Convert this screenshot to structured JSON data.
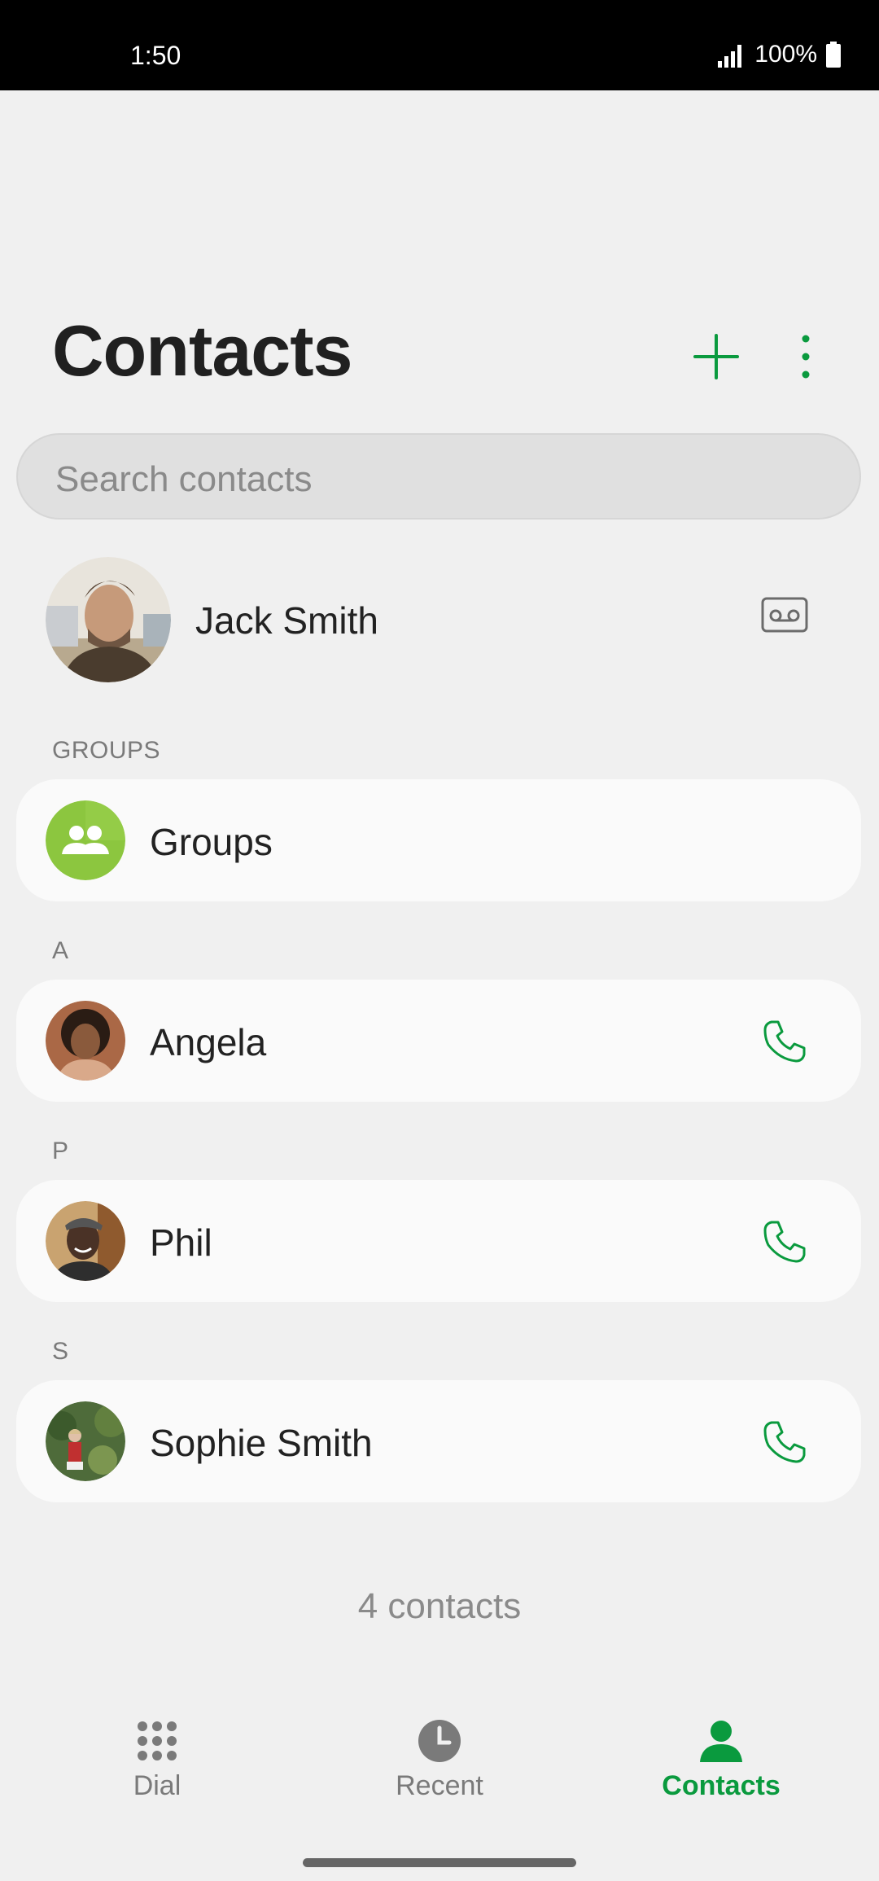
{
  "status_bar": {
    "time": "1:50",
    "battery": "100%"
  },
  "header": {
    "title": "Contacts"
  },
  "search": {
    "placeholder": "Search contacts"
  },
  "profile": {
    "name": "Jack Smith"
  },
  "sections": {
    "groups_label": "GROUPS",
    "a_label": "A",
    "p_label": "P",
    "s_label": "S"
  },
  "groups_card": {
    "label": "Groups"
  },
  "contacts": [
    {
      "name": "Angela"
    },
    {
      "name": "Phil"
    },
    {
      "name": "Sophie Smith"
    }
  ],
  "footer": {
    "count": "4 contacts"
  },
  "nav": {
    "dial": "Dial",
    "recent": "Recent",
    "contacts": "Contacts"
  },
  "colors": {
    "accent": "#0a9a3e",
    "groups_avatar": "#8cc63f",
    "background": "#f0f0f0",
    "card": "#fafafa"
  },
  "icons": [
    "signal-icon",
    "battery-icon",
    "plus-icon",
    "more-vert-icon",
    "voicemail-icon",
    "group-icon",
    "phone-icon",
    "dialpad-icon",
    "clock-icon",
    "person-icon"
  ]
}
